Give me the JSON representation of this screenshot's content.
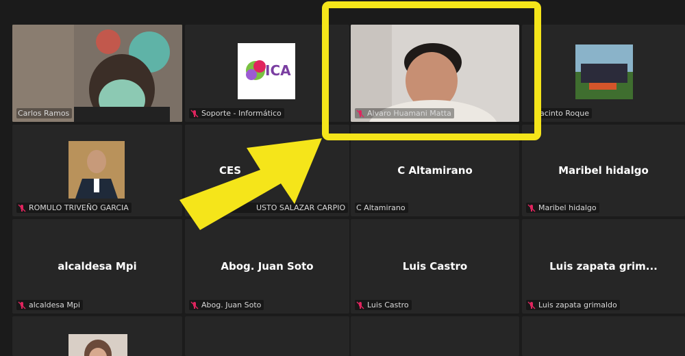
{
  "participants_row1": {
    "carlos": "Carlos Ramos",
    "soporte": "Soporte - Informático",
    "alvaro": "Alvaro Huamani Matta",
    "jacinto": "acinto Roque"
  },
  "participants_row2": {
    "romulo_label": "ROMULO TRIVEÑO GARCIA",
    "cesar_center": "CES",
    "cesar_label": "USTO SALAZAR CARPIO",
    "altamirano_center": "C Altamirano",
    "altamirano_label": "C Altamirano",
    "maribel_center": "Maribel hidalgo",
    "maribel_label": "Maribel hidalgo"
  },
  "participants_row3": {
    "alcaldesa_center": "alcaldesa Mpi",
    "alcaldesa_label": "alcaldesa Mpi",
    "soto_center": "Abog. Juan Soto",
    "soto_label": "Abog. Juan Soto",
    "castro_center": "Luis Castro",
    "castro_label": "Luis Castro",
    "zapata_center": "Luis zapata grim...",
    "zapata_label": "Luis zapata grimaldo"
  },
  "logo": {
    "text": "ICA"
  },
  "colors": {
    "highlight": "#f5e51a",
    "arrow": "#f5e51a",
    "speaking_border": "#c8f06a",
    "muted_mic": "#e0245e"
  }
}
